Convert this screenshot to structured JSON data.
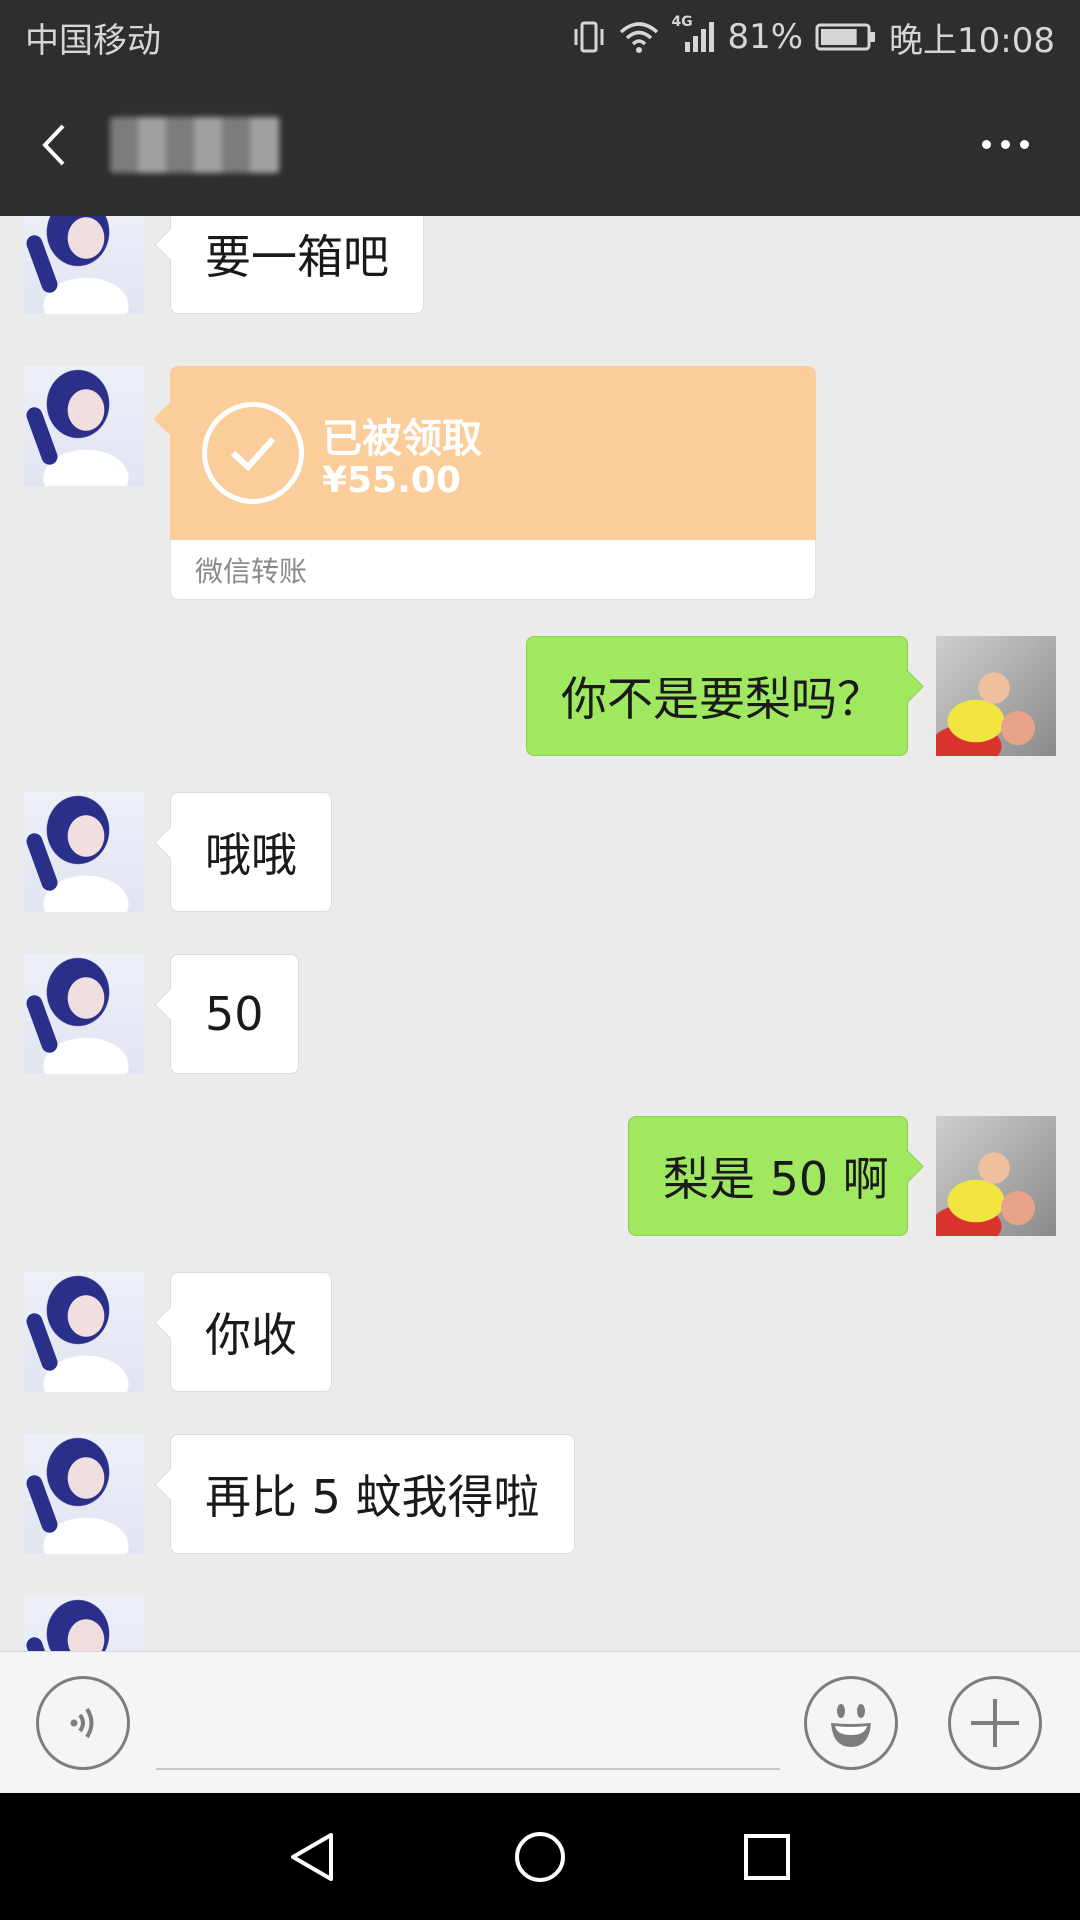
{
  "status_bar": {
    "carrier": "中国移动",
    "network": "4G",
    "battery": "81%",
    "time": "晚上10:08",
    "battery_level": 0.81
  },
  "header": {
    "title": ""
  },
  "messages": [
    {
      "side": "left",
      "text": "要一箱吧"
    },
    {
      "side": "left",
      "type": "transfer",
      "status": "已被领取",
      "amount": "¥55.00",
      "label": "微信转账"
    },
    {
      "side": "right",
      "text": "你不是要梨吗？"
    },
    {
      "side": "left",
      "text": "哦哦"
    },
    {
      "side": "left",
      "text": "50"
    },
    {
      "side": "right",
      "text": "梨是 50 啊"
    },
    {
      "side": "left",
      "text": "你收"
    },
    {
      "side": "left",
      "text": "再比 5 蚊我得啦"
    }
  ],
  "input": {
    "value": "",
    "placeholder": ""
  },
  "icons": {
    "back": "back-arrow-icon",
    "more": "more-dots-icon",
    "voice": "voice-icon",
    "emoji": "emoji-icon",
    "plus": "plus-icon",
    "nav_back": "nav-back-icon",
    "nav_home": "nav-home-icon",
    "nav_recent": "nav-recent-icon"
  },
  "colors": {
    "header_bg": "#2e2e2e",
    "chat_bg": "#ebebeb",
    "my_bubble": "#9fe85f",
    "their_bubble": "#ffffff",
    "transfer": "#fbcd9b"
  }
}
